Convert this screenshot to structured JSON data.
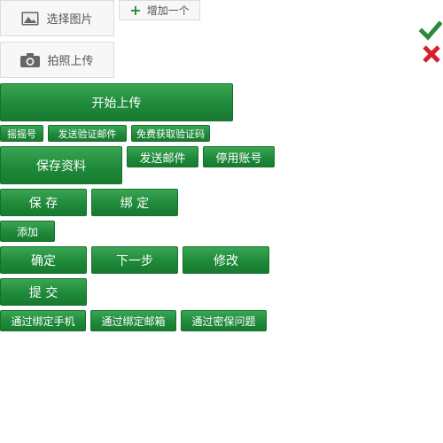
{
  "upload": {
    "choose_image_label": "选择图片",
    "take_photo_label": "拍照上传",
    "add_more_label": "增加一个",
    "start_upload_label": "开始上传"
  },
  "row1": {
    "shake_label": "摇摇号",
    "send_code_email_label": "发送验证邮件",
    "free_code_label": "免费获取验证码"
  },
  "row2": {
    "save_info_label": "保存资料",
    "send_email_label": "发送邮件",
    "disable_account_label": "停用账号"
  },
  "row3": {
    "save_label": "保 存",
    "bind_label": "绑 定"
  },
  "row4": {
    "add_label": "添加"
  },
  "row5": {
    "confirm_label": "确定",
    "next_label": "下一步",
    "edit_label": "修改"
  },
  "row6": {
    "submit_label": "提 交"
  },
  "row7": {
    "via_phone_label": "通过绑定手机",
    "via_email_label": "通过绑定邮箱",
    "via_question_label": "通过密保问题"
  },
  "colors": {
    "button_green": "#1f8a3a",
    "check_green": "#2a8a3c",
    "cross_red": "#d6202b"
  },
  "icons": {
    "image": "image-icon",
    "camera": "camera-icon",
    "plus": "plus-icon",
    "check": "checkmark-icon",
    "cross": "cross-icon"
  }
}
